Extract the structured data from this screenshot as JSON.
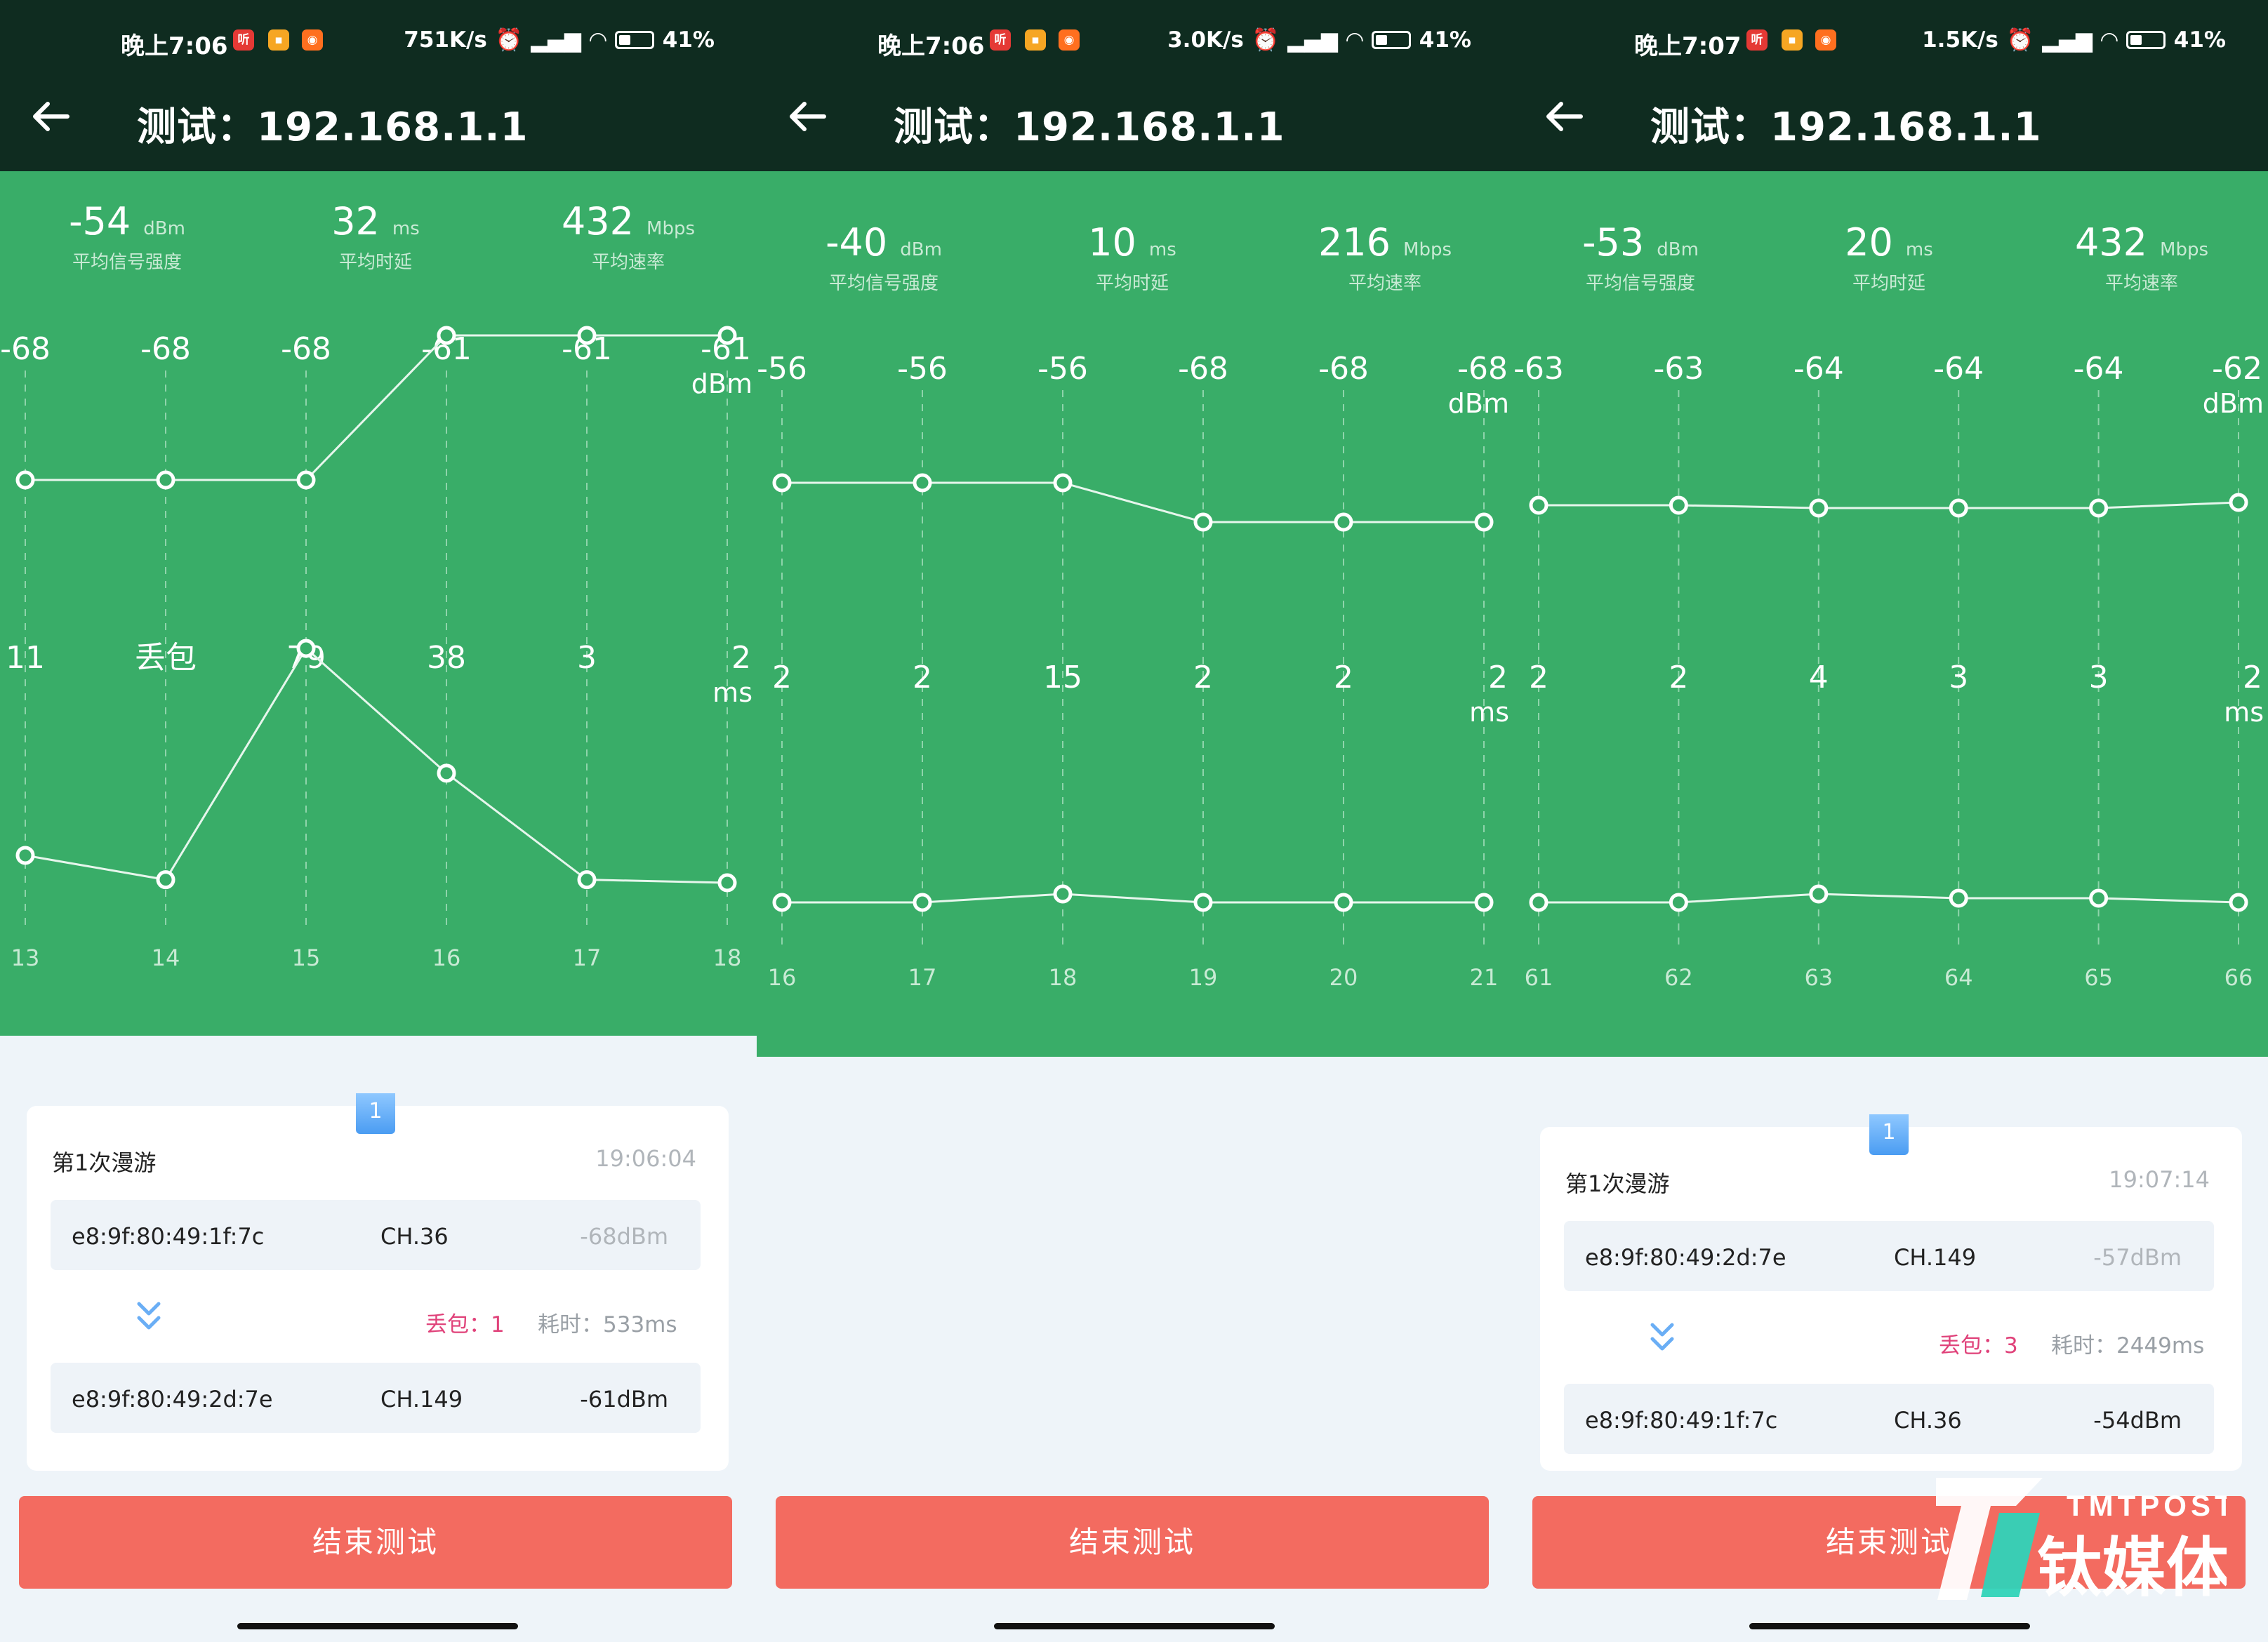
{
  "panels": [
    {
      "status": {
        "time": "晚上7:06",
        "net": "751K/s",
        "battery": "41%"
      },
      "title": "测试：192.168.1.1",
      "stats": [
        {
          "value": "-54",
          "unit": "dBm",
          "label": "平均信号强度"
        },
        {
          "value": "32",
          "unit": "ms",
          "label": "平均时延"
        },
        {
          "value": "432",
          "unit": "Mbps",
          "label": "平均速率"
        }
      ],
      "signal": {
        "labels": [
          "-68",
          "-68",
          "-68",
          "-61",
          "-61",
          "-61"
        ],
        "values": [
          -68,
          -68,
          -68,
          -61,
          -61,
          -61
        ],
        "unit": "dBm"
      },
      "latency": {
        "labels": [
          "11",
          "丢包",
          "79",
          "38",
          "3",
          "2"
        ],
        "values": [
          11,
          3,
          79,
          38,
          3,
          2
        ],
        "unit": "ms"
      },
      "x_ticks": [
        "13",
        "14",
        "15",
        "16",
        "17",
        "18"
      ],
      "roam": {
        "badge": "1",
        "title": "第1次漫游",
        "time": "19:06:04",
        "from": {
          "mac": "e8:9f:80:49:1f:7c",
          "ch": "CH.36",
          "dbm": "-68dBm"
        },
        "loss": "丢包：1",
        "cost": "耗时：533ms",
        "to": {
          "mac": "e8:9f:80:49:2d:7e",
          "ch": "CH.149",
          "dbm": "-61dBm"
        }
      },
      "end_button": "结束测试"
    },
    {
      "status": {
        "time": "晚上7:06",
        "net": "3.0K/s",
        "battery": "41%"
      },
      "title": "测试：192.168.1.1",
      "stats": [
        {
          "value": "-40",
          "unit": "dBm",
          "label": "平均信号强度"
        },
        {
          "value": "10",
          "unit": "ms",
          "label": "平均时延"
        },
        {
          "value": "216",
          "unit": "Mbps",
          "label": "平均速率"
        }
      ],
      "signal": {
        "labels": [
          "-56",
          "-56",
          "-56",
          "-68",
          "-68",
          "-68"
        ],
        "values": [
          -56,
          -56,
          -56,
          -68,
          -68,
          -68
        ],
        "unit": "dBm"
      },
      "latency": {
        "labels": [
          "2",
          "2",
          "15",
          "2",
          "2",
          "2"
        ],
        "values": [
          2,
          2,
          15,
          2,
          2,
          2
        ],
        "unit": "ms"
      },
      "x_ticks": [
        "16",
        "17",
        "18",
        "19",
        "20",
        "21"
      ],
      "end_button": "结束测试"
    },
    {
      "status": {
        "time": "晚上7:07",
        "net": "1.5K/s",
        "battery": "41%"
      },
      "title": "测试：192.168.1.1",
      "stats": [
        {
          "value": "-53",
          "unit": "dBm",
          "label": "平均信号强度"
        },
        {
          "value": "20",
          "unit": "ms",
          "label": "平均时延"
        },
        {
          "value": "432",
          "unit": "Mbps",
          "label": "平均速率"
        }
      ],
      "signal": {
        "labels": [
          "-63",
          "-63",
          "-64",
          "-64",
          "-64",
          "-62"
        ],
        "values": [
          -63,
          -63,
          -64,
          -64,
          -64,
          -62
        ],
        "unit": "dBm"
      },
      "latency": {
        "labels": [
          "2",
          "2",
          "4",
          "3",
          "3",
          "2"
        ],
        "values": [
          2,
          2,
          4,
          3,
          3,
          2
        ],
        "unit": "ms"
      },
      "x_ticks": [
        "61",
        "62",
        "63",
        "64",
        "65",
        "66"
      ],
      "roam": {
        "badge": "1",
        "title": "第1次漫游",
        "time": "19:07:14",
        "from": {
          "mac": "e8:9f:80:49:2d:7e",
          "ch": "CH.149",
          "dbm": "-57dBm"
        },
        "loss": "丢包：3",
        "cost": "耗时：2449ms",
        "to": {
          "mac": "e8:9f:80:49:1f:7c",
          "ch": "CH.36",
          "dbm": "-54dBm"
        }
      },
      "end_button": "结束测试"
    }
  ],
  "watermark": {
    "brand_en": "TMTPOST",
    "brand_cn": "钛媒体"
  },
  "colors": {
    "green": "#39ad68",
    "header": "#0f2c20",
    "button": "#f36b60",
    "loss": "#e0427a"
  }
}
